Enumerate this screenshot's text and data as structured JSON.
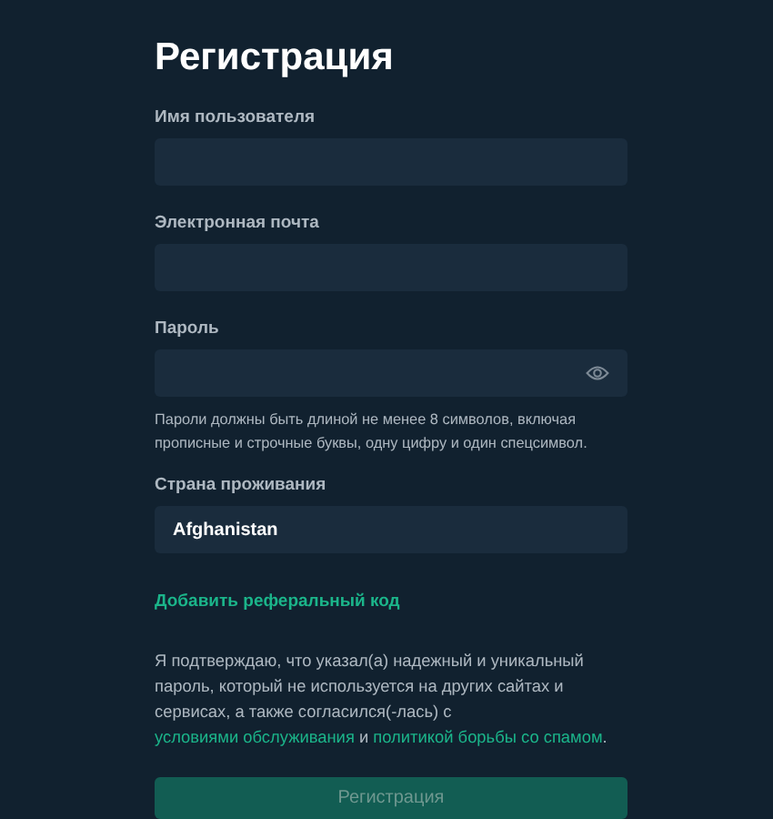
{
  "title": "Регистрация",
  "fields": [
    {
      "kind": "text",
      "label": "Имя пользователя"
    },
    {
      "kind": "text",
      "label": "Электронная почта"
    },
    {
      "kind": "password",
      "label": "Пароль",
      "hint": "Пароли должны быть длиной не менее 8 символов, включая прописные и строчные буквы, одну цифру и один спецсимвол."
    },
    {
      "kind": "select",
      "label": "Страна проживания",
      "value": "Afghanistan"
    }
  ],
  "referral_link": "Добавить реферальный код",
  "consent": [
    {
      "kind": "text",
      "text": "Я подтверждаю, что указал(а) надежный и уникальный пароль, который не используется на других сайтах и сервисах, а также согласился(-лась) с "
    },
    {
      "kind": "link",
      "text": "условиями обслуживания"
    },
    {
      "kind": "text",
      "text": " и "
    },
    {
      "kind": "link",
      "text": "политикой борьбы со спамом"
    },
    {
      "kind": "text",
      "text": "."
    }
  ],
  "submit": {
    "label": "Регистрация",
    "disabled": true
  }
}
